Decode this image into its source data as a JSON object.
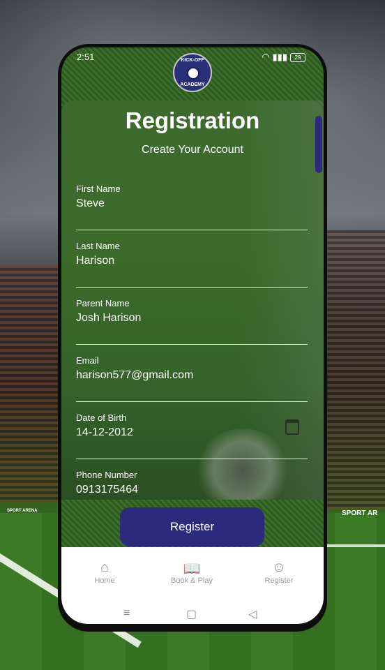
{
  "status_bar": {
    "time": "2:51",
    "battery": "29"
  },
  "logo": {
    "top_text": "KICK-OFF",
    "bottom_text": "ACADEMY"
  },
  "header": {
    "title": "Registration",
    "subtitle": "Create Your Account"
  },
  "form": {
    "fields": [
      {
        "label": "First Name",
        "value": "Steve"
      },
      {
        "label": "Last Name",
        "value": "Harison"
      },
      {
        "label": "Parent Name",
        "value": "Josh Harison"
      },
      {
        "label": "Email",
        "value": "harison577@gmail.com"
      },
      {
        "label": "Date of Birth",
        "value": "14-12-2012",
        "icon": "calendar-icon"
      },
      {
        "label": "Phone Number",
        "value": "0913175464"
      }
    ],
    "submit_label": "Register"
  },
  "bottom_nav": {
    "items": [
      {
        "label": "Home",
        "icon": "home-icon"
      },
      {
        "label": "Book & Play",
        "icon": "book-icon"
      },
      {
        "label": "Register",
        "icon": "register-icon"
      }
    ]
  },
  "background": {
    "left_sign": "SPORT ARENA",
    "right_sign": "SPORT AR"
  },
  "colors": {
    "accent": "#2c2a7c",
    "card": "#3b6a2a",
    "nav_bg": "#ffffff"
  }
}
